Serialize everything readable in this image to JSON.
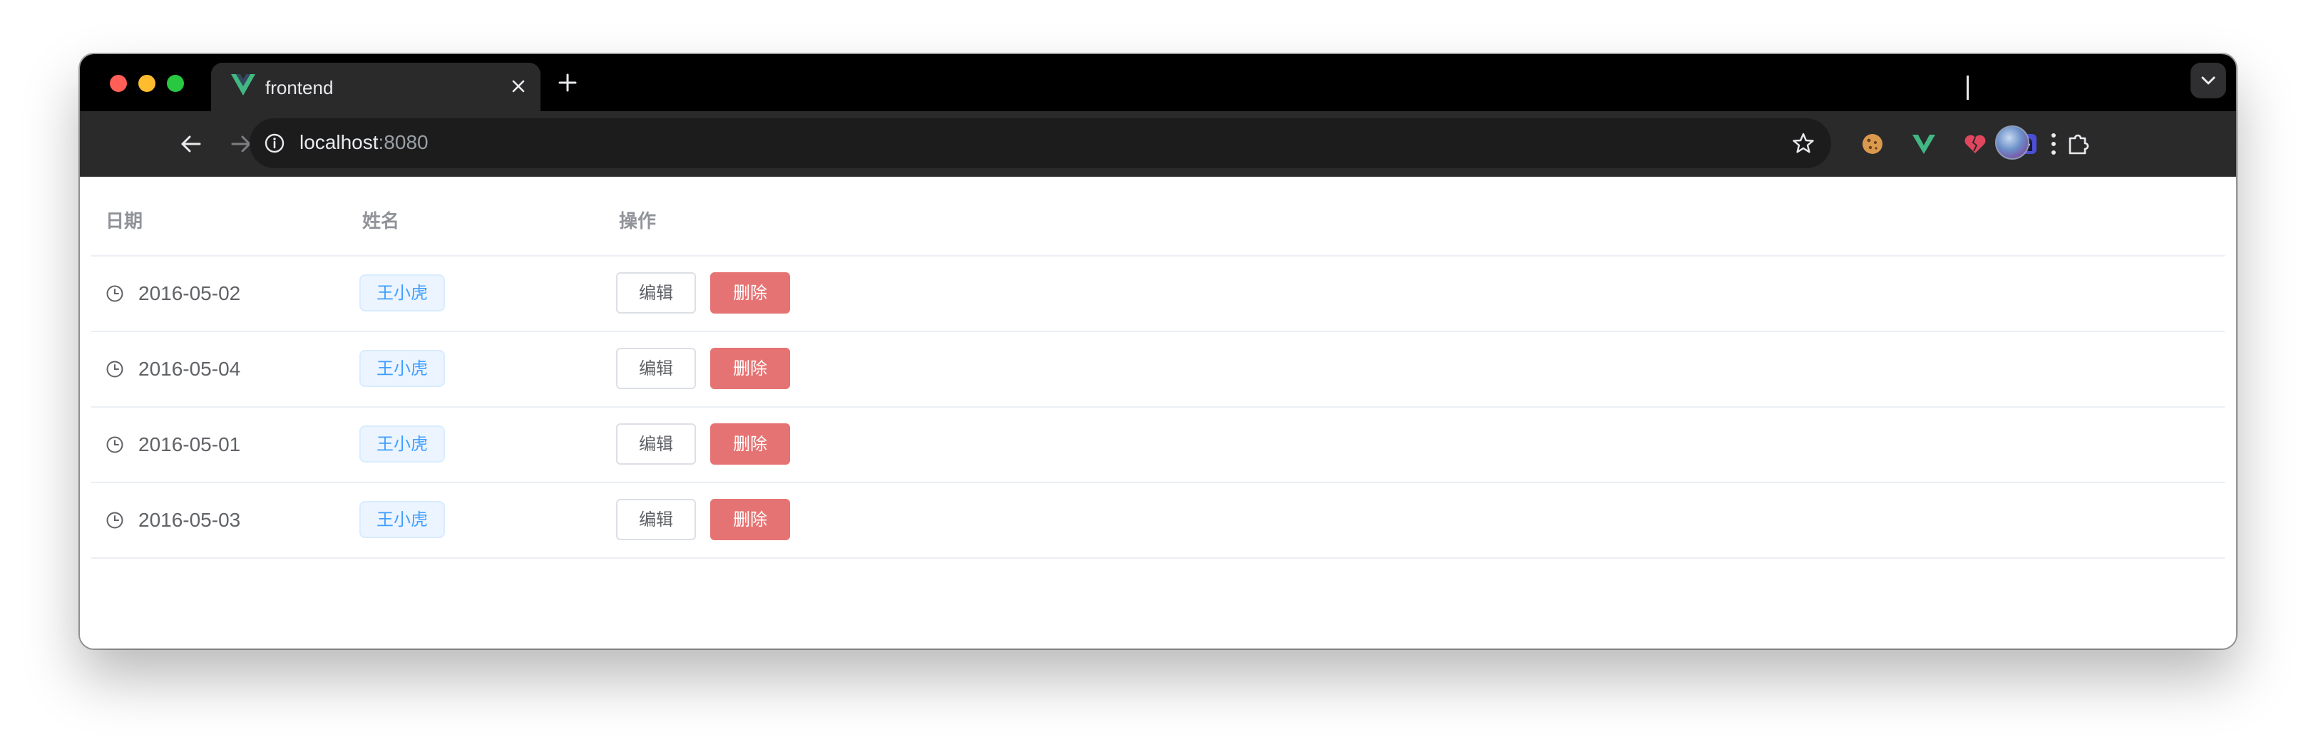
{
  "browser": {
    "tab": {
      "title": "frontend",
      "favicon": "vue-logo-icon"
    },
    "address_bar": {
      "host": "localhost",
      "port": ":8080"
    },
    "extensions": [
      "cookie-extension-icon",
      "vue-devtools-icon",
      "broken-heart-extension-icon",
      "ghost-extension-icon",
      "puzzle-extensions-icon"
    ],
    "colors": {
      "tabstrip": "#000000",
      "toolbar": "#2a2a2b"
    }
  },
  "table": {
    "headers": {
      "date": "日期",
      "name": "姓名",
      "actions": "操作"
    },
    "rows": [
      {
        "date": "2016-05-02",
        "name": "王小虎",
        "edit": "编辑",
        "delete": "删除"
      },
      {
        "date": "2016-05-04",
        "name": "王小虎",
        "edit": "编辑",
        "delete": "删除"
      },
      {
        "date": "2016-05-01",
        "name": "王小虎",
        "edit": "编辑",
        "delete": "删除"
      },
      {
        "date": "2016-05-03",
        "name": "王小虎",
        "edit": "编辑",
        "delete": "删除"
      }
    ],
    "colors": {
      "tag_text": "#409eff",
      "tag_bg": "#ecf5ff",
      "delete_bg": "#e67373",
      "header_text": "#909399",
      "cell_text": "#606266"
    }
  }
}
